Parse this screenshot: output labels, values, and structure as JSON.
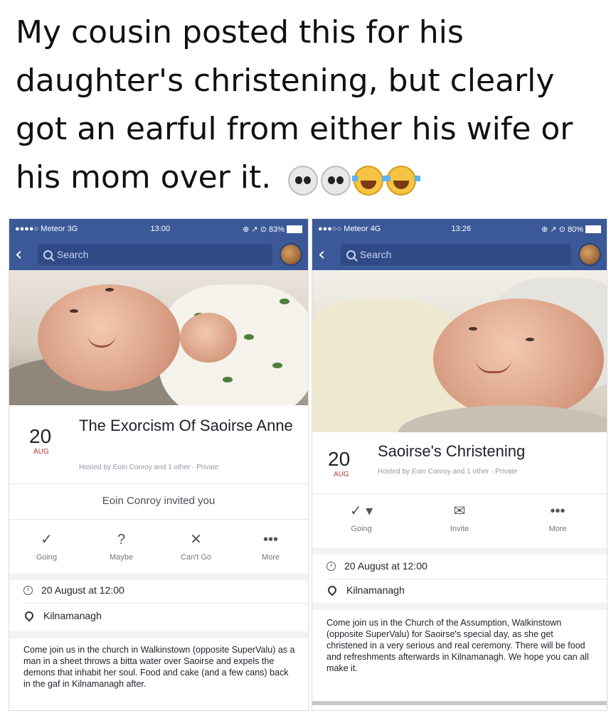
{
  "caption": "My cousin posted this for his daughter's christening, but clearly got an earful from either his wife or his mom over it.",
  "caption_emojis": [
    "skull-emoji",
    "skull-emoji",
    "tears-of-joy-emoji",
    "tears-of-joy-emoji"
  ],
  "colors": {
    "facebook_blue": "#3b5998",
    "search_bg": "#2f4a86",
    "month_red": "#b33333"
  },
  "left_phone": {
    "status": {
      "carrier": "●●●●○ Meteor  3G",
      "time": "13:00",
      "battery": "⊕ ↗ ⊙ 83%"
    },
    "search_placeholder": "Search",
    "event": {
      "day": "20",
      "month": "AUG",
      "title": "The Exorcism Of Saoirse Anne",
      "hosted": "Hosted by Eoin Conroy and 1 other · Private"
    },
    "invited": "Eoin Conroy invited you",
    "actions": [
      {
        "icon": "✓",
        "label": "Going"
      },
      {
        "icon": "?",
        "label": "Maybe"
      },
      {
        "icon": "✕",
        "label": "Can't Go"
      },
      {
        "icon": "•••",
        "label": "More"
      }
    ],
    "when": "20 August at 12:00",
    "where": "Kilnamanagh",
    "description": "Come join us in the church in Walkinstown (opposite SuperValu) as a man in a sheet throws a bitta water over Saoirse and expels the demons that inhabit her soul. Food and cake (and a few cans) back in the gaf in Kilnamanagh after."
  },
  "right_phone": {
    "status": {
      "carrier": "●●●○○ Meteor  4G",
      "time": "13:26",
      "battery": "⊕ ↗ ⊙ 80%"
    },
    "search_placeholder": "Search",
    "event": {
      "day": "20",
      "month": "AUG",
      "title": "Saoirse's Christening",
      "hosted": "Hosted by Eoin Conroy and 1 other · Private"
    },
    "actions": [
      {
        "icon": "✓ ▾",
        "label": "Going"
      },
      {
        "icon": "✉",
        "label": "Invite"
      },
      {
        "icon": "•••",
        "label": "More"
      }
    ],
    "when": "20 August at 12:00",
    "where": "Kilnamanagh",
    "description": "Come join us in the Church of the Assumption, Walkinstown (opposite SuperValu) for Saoirse's special day, as she get christened in a very serious and real ceremony. There will be food and refreshments afterwards in Kilnamanagh. We hope you can all make it."
  }
}
